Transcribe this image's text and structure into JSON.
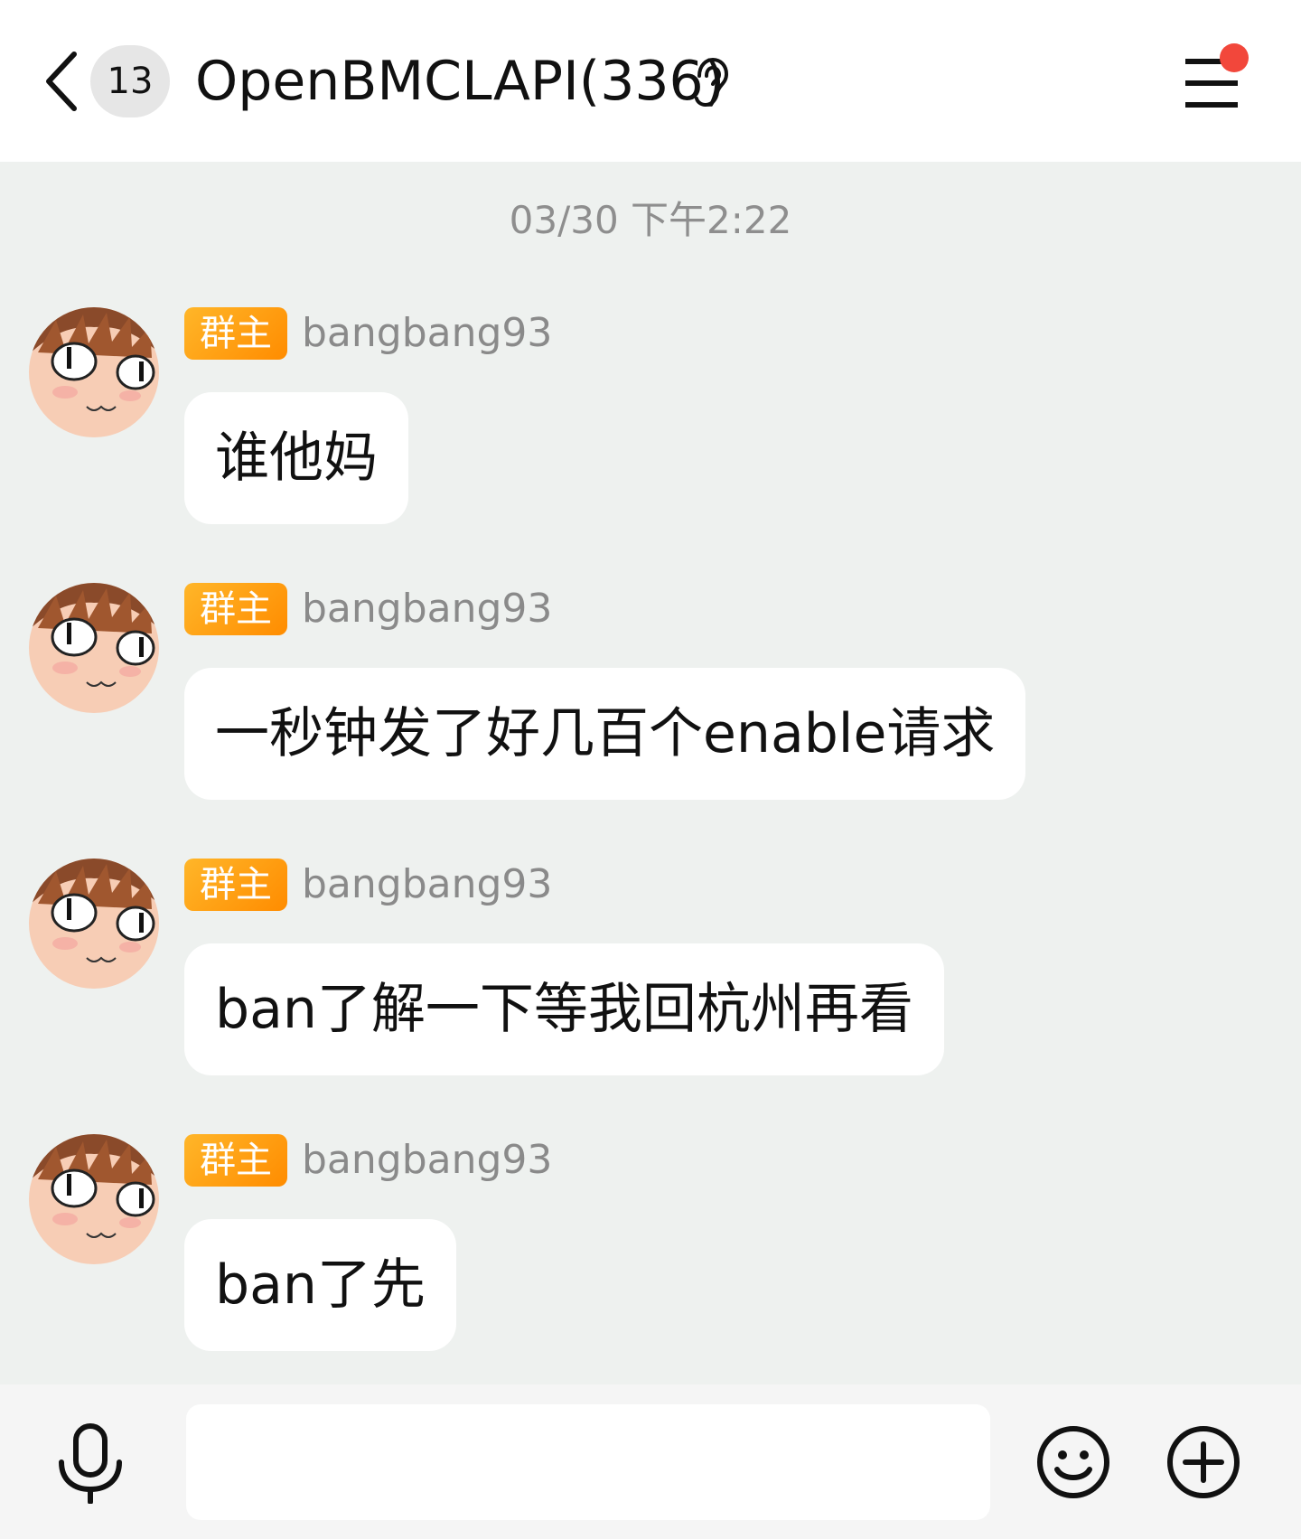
{
  "header": {
    "unread_count": "13",
    "title": "OpenBMCLAPI(336)"
  },
  "timestamp": "03/30 下午2:22",
  "messages": [
    {
      "role": "群主",
      "sender": "bangbang93",
      "text": "谁他妈"
    },
    {
      "role": "群主",
      "sender": "bangbang93",
      "text": "一秒钟发了好几百个enable请求"
    },
    {
      "role": "群主",
      "sender": "bangbang93",
      "text": "ban了解一下等我回杭州再看"
    },
    {
      "role": "群主",
      "sender": "bangbang93",
      "text": "ban了先"
    }
  ],
  "input": {
    "value": ""
  },
  "colors": {
    "background": "#eef1ef",
    "badge_orange": "#ff9a10",
    "notification_dot": "#f2473b"
  }
}
